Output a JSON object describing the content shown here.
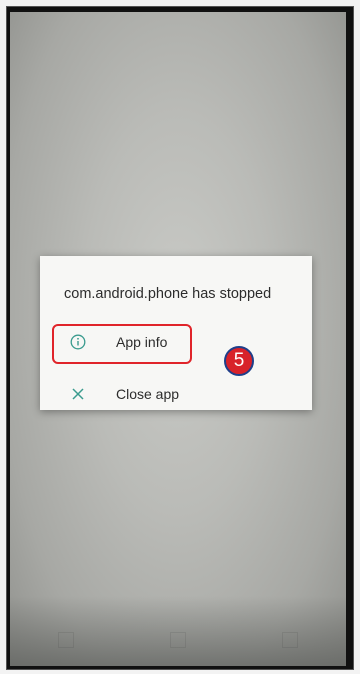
{
  "dialog": {
    "title": "com.android.phone has stopped",
    "items": [
      {
        "label": "App info",
        "icon": "info-circle-icon"
      },
      {
        "label": "Close app",
        "icon": "close-x-icon"
      }
    ]
  },
  "annotation": {
    "step_number": "5",
    "highlight_color": "#e0242a",
    "badge_color": "#d8222a"
  },
  "colors": {
    "icon_accent": "#3a9b8e"
  }
}
